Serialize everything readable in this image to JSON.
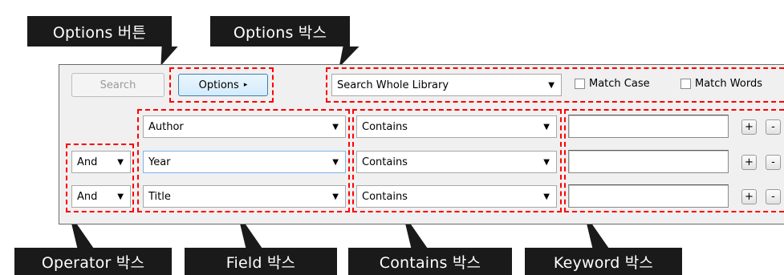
{
  "callouts": {
    "options_button": "Options 버튼",
    "options_box": "Options 박스",
    "operator_box": "Operator 박스",
    "field_box": "Field 박스",
    "contains_box": "Contains 박스",
    "keyword_box": "Keyword 박스"
  },
  "toolbar": {
    "search_label": "Search",
    "options_label": "Options",
    "options_arrow": "▸",
    "scope_value": "Search Whole Library",
    "match_case_label": "Match Case",
    "match_words_label": "Match Words"
  },
  "rows": [
    {
      "operator": "",
      "field": "Author",
      "condition": "Contains",
      "keyword": ""
    },
    {
      "operator": "And",
      "field": "Year",
      "condition": "Contains",
      "keyword": ""
    },
    {
      "operator": "And",
      "field": "Title",
      "condition": "Contains",
      "keyword": ""
    }
  ],
  "row_buttons": {
    "add": "+",
    "remove": "-"
  },
  "glyphs": {
    "dropdown_arrow": "▼"
  },
  "colors": {
    "annotation_red": "#ff0000",
    "callout_bg": "#1a1a1a",
    "options_border": "#3c7fb1"
  }
}
